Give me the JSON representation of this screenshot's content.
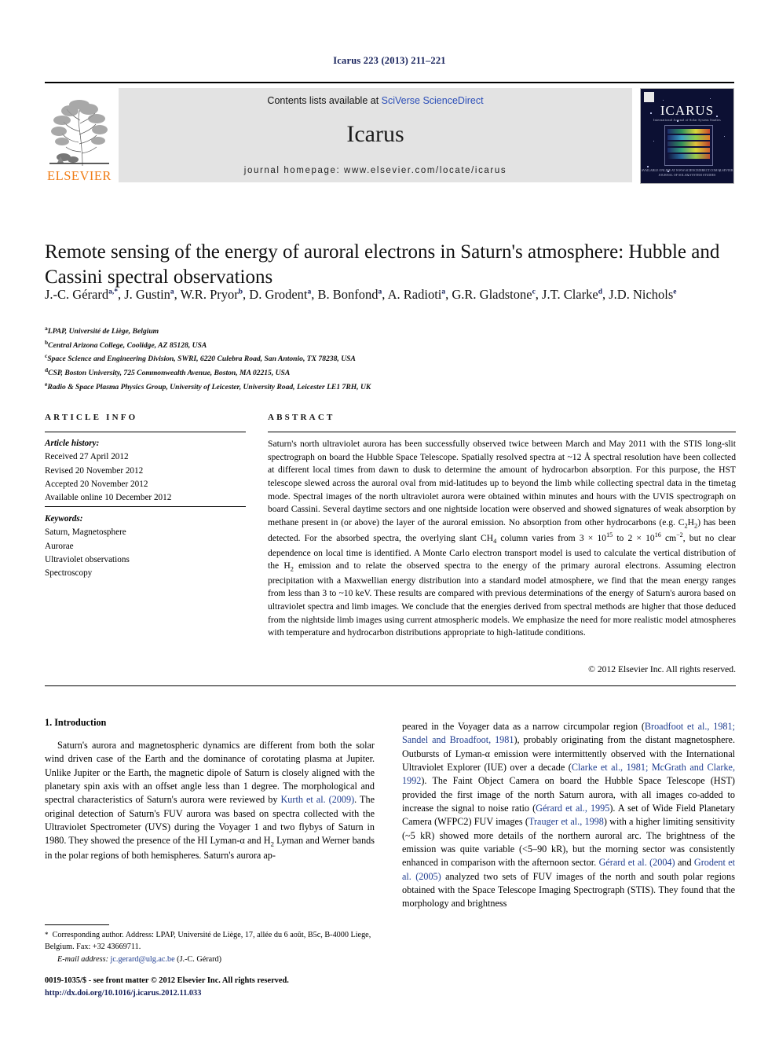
{
  "running_head": "Icarus 223 (2013) 211–221",
  "masthead": {
    "contents_prefix": "Contents lists available at ",
    "sciencedirect_link": "SciVerse ScienceDirect",
    "journal_title": "Icarus",
    "homepage": "journal homepage: www.elsevier.com/locate/icarus",
    "publisher_wordmark": "ELSEVIER",
    "cover_title": "ICARUS",
    "cover_subtitle": "International Journal of Solar System Studies",
    "cover_footer": "AVAILABLE ONLINE AT WWW.SCIENCEDIRECT.COM\nELSEVIER JOURNAL OF SOLAR SYSTEM STUDIES"
  },
  "article": {
    "title": "Remote sensing of the energy of auroral electrons in Saturn's atmosphere: Hubble and Cassini spectral observations",
    "authors_html": "J.-C. Gérard<sup>a,*</sup>, J. Gustin<sup>a</sup>, W.R. Pryor<sup>b</sup>, D. Grodent<sup>a</sup>, B. Bonfond<sup>a</sup>, A. Radioti<sup>a</sup>, G.R. Gladstone<sup>c</sup>, J.T. Clarke<sup>d</sup>, J.D. Nichols<sup>e</sup>",
    "affiliations": [
      {
        "mark": "a",
        "text": "LPAP, Université de Liège, Belgium"
      },
      {
        "mark": "b",
        "text": "Central Arizona College, Coolidge, AZ 85128, USA"
      },
      {
        "mark": "c",
        "text": "Space Science and Engineering Division, SWRI, 6220 Culebra Road, San Antonio, TX 78238, USA"
      },
      {
        "mark": "d",
        "text": "CSP, Boston University, 725 Commonwealth Avenue, Boston, MA 02215, USA"
      },
      {
        "mark": "e",
        "text": "Radio & Space Plasma Physics Group, University of Leicester, University Road, Leicester LE1 7RH, UK"
      }
    ]
  },
  "article_info": {
    "heading": "ARTICLE INFO",
    "history_label": "Article history:",
    "history": [
      "Received 27 April 2012",
      "Revised 20 November 2012",
      "Accepted 20 November 2012",
      "Available online 10 December 2012"
    ],
    "keywords_label": "Keywords:",
    "keywords": [
      "Saturn, Magnetosphere",
      "Aurorae",
      "Ultraviolet observations",
      "Spectroscopy"
    ]
  },
  "abstract": {
    "heading": "ABSTRACT",
    "text_html": "Saturn's north ultraviolet aurora has been successfully observed twice between March and May 2011 with the STIS long-slit spectrograph on board the Hubble Space Telescope. Spatially resolved spectra at ~12 Å spectral resolution have been collected at different local times from dawn to dusk to determine the amount of hydrocarbon absorption. For this purpose, the HST telescope slewed across the auroral oval from mid-latitudes up to beyond the limb while collecting spectral data in the timetag mode. Spectral images of the north ultraviolet aurora were obtained within minutes and hours with the UVIS spectrograph on board Cassini. Several daytime sectors and one nightside location were observed and showed signatures of weak absorption by methane present in (or above) the layer of the auroral emission. No absorption from other hydrocarbons (e.g. C<sub>2</sub>H<sub>2</sub>) has been detected. For the absorbed spectra, the overlying slant CH<sub>4</sub> column varies from 3 &times; 10<sup class=\"sm\">15</sup> to 2 &times; 10<sup class=\"sm\">16</sup> cm<sup class=\"sm\">&minus;2</sup>, but no clear dependence on local time is identified. A Monte Carlo electron transport model is used to calculate the vertical distribution of the H<sub>2</sub> emission and to relate the observed spectra to the energy of the primary auroral electrons. Assuming electron precipitation with a Maxwellian energy distribution into a standard model atmosphere, we find that the mean energy ranges from less than 3 to ~10 keV. These results are compared with previous determinations of the energy of Saturn's aurora based on ultraviolet spectra and limb images. We conclude that the energies derived from spectral methods are higher that those deduced from the nightside limb images using current atmospheric models. We emphasize the need for more realistic model atmospheres with temperature and hydrocarbon distributions appropriate to high-latitude conditions.",
    "copyright": "© 2012 Elsevier Inc. All rights reserved."
  },
  "body": {
    "section_number_title": "1. Introduction",
    "left_column_html": "Saturn's aurora and magnetospheric dynamics are different from both the solar wind driven case of the Earth and the dominance of corotating plasma at Jupiter. Unlike Jupiter or the Earth, the magnetic dipole of Saturn is closely aligned with the planetary spin axis with an offset angle less than 1 degree. The morphological and spectral characteristics of Saturn's aurora were reviewed by <span class=\"cit\">Kurth et al. (2009)</span>. The original detection of Saturn's FUV aurora was based on spectra collected with the Ultraviolet Spectrometer (UVS) during the Voyager 1 and two flybys of Saturn in 1980. They showed the presence of the HI Lyman-&alpha; and H<sub>2</sub> Lyman and Werner bands in the polar regions of both hemispheres. Saturn's aurora ap-",
    "right_column_html": "peared in the Voyager data as a narrow circumpolar region (<span class=\"cit\">Broadfoot et al., 1981; Sandel and Broadfoot, 1981</span>), probably originating from the distant magnetosphere. Outbursts of Lyman-&alpha; emission were intermittently observed with the International Ultraviolet Explorer (IUE) over a decade (<span class=\"cit\">Clarke et al., 1981; McGrath and Clarke, 1992</span>). The Faint Object Camera on board the Hubble Space Telescope (HST) provided the first image of the north Saturn aurora, with all images co-added to increase the signal to noise ratio (<span class=\"cit\">Gérard et al., 1995</span>). A set of Wide Field Planetary Camera (WFPC2) FUV images (<span class=\"cit\">Trauger et al., 1998</span>) with a higher limiting sensitivity (~5 kR) showed more details of the northern auroral arc. The brightness of the emission was quite variable (&lt;5&ndash;90 kR), but the morning sector was consistently enhanced in comparison with the afternoon sector. <span class=\"cit\">Gérard et al. (2004)</span> and <span class=\"cit\">Grodent et al. (2005)</span> analyzed two sets of FUV images of the north and south polar regions obtained with the Space Telescope Imaging Spectrograph (STIS). They found that the morphology and brightness"
  },
  "footnotes": {
    "corresponding_html": "<span class=\"star\">*</span>&nbsp; Corresponding author. Address: LPAP, Université de Liège, 17, allée du 6 août, B5c, B-4000 Liege, Belgium. Fax: +32 43669711.",
    "email_label": "E-mail address:",
    "email": "jc.gerard@ulg.ac.be",
    "email_owner": "(J.-C. Gérard)"
  },
  "imprint": {
    "line1": "0019-1035/$ - see front matter © 2012 Elsevier Inc. All rights reserved.",
    "doi": "http://dx.doi.org/10.1016/j.icarus.2012.11.033"
  },
  "colors": {
    "link_blue": "#1f3d8f",
    "header_navy": "#16215b",
    "elsevier_orange": "#f07c15",
    "banner_gray": "#e3e3e3"
  }
}
